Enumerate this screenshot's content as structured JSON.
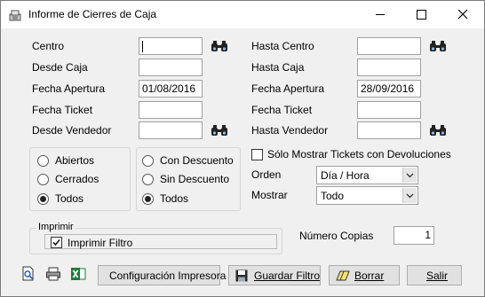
{
  "window": {
    "title": "Informe de Cierres de Caja"
  },
  "left": {
    "centro_label": "Centro",
    "centro_value": "",
    "desde_caja_label": "Desde Caja",
    "desde_caja_value": "",
    "fecha_apertura_label": "Fecha Apertura",
    "fecha_apertura_value": "01/08/2016",
    "fecha_ticket_label": "Fecha Ticket",
    "fecha_ticket_value": "",
    "desde_vendedor_label": "Desde Vendedor",
    "desde_vendedor_value": ""
  },
  "right": {
    "hasta_centro_label": "Hasta Centro",
    "hasta_centro_value": "",
    "hasta_caja_label": "Hasta Caja",
    "hasta_caja_value": "",
    "fecha_apertura_label": "Fecha Apertura",
    "fecha_apertura_value": "28/09/2016",
    "fecha_ticket_label": "Fecha Ticket",
    "fecha_ticket_value": "",
    "hasta_vendedor_label": "Hasta Vendedor",
    "hasta_vendedor_value": ""
  },
  "estado_group": {
    "options": [
      "Abiertos",
      "Cerrados",
      "Todos"
    ],
    "selected": "Todos"
  },
  "descuento_group": {
    "options": [
      "Con Descuento",
      "Sin Descuento",
      "Todos"
    ],
    "selected": "Todos"
  },
  "devoluciones_checkbox": {
    "label": "Sólo Mostrar Tickets con Devoluciones",
    "checked": false
  },
  "orden": {
    "label": "Orden",
    "value": "Día / Hora"
  },
  "mostrar": {
    "label": "Mostrar",
    "value": "Todo"
  },
  "imprimir": {
    "group_label": "Imprimir",
    "filtro_label": "Imprimir Filtro",
    "filtro_checked": true
  },
  "copias": {
    "label": "Número Copias",
    "value": "1"
  },
  "buttons": {
    "config_impresora": "Configuración Impresora",
    "guardar_filtro": "Guardar Filtro",
    "borrar": "Borrar",
    "salir": "Salir"
  },
  "icons": {
    "app": "register-icon",
    "search": "binoculars-icon",
    "preview": "print-preview-icon",
    "print": "printer-icon",
    "excel": "excel-icon",
    "save": "floppy-disk-icon",
    "erase": "eraser-icon"
  },
  "colors": {
    "check_mark": "#1c1c1c",
    "accent_blue": "#1f5fb4",
    "excel_green": "#1d7a3c"
  }
}
